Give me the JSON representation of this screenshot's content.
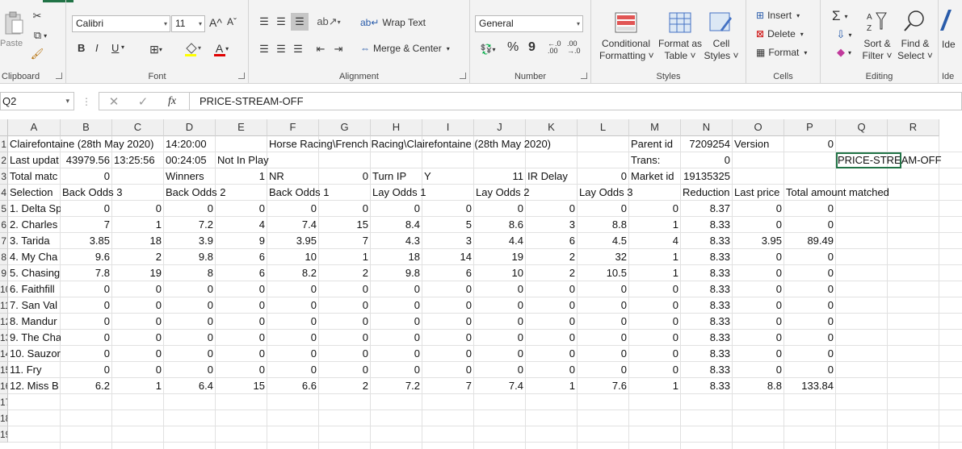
{
  "ribbon": {
    "clipboard": {
      "label": "Clipboard",
      "paste": "Paste"
    },
    "font": {
      "label": "Font",
      "name": "Calibri",
      "size": "11",
      "grow": "A^",
      "shrink": "Aˇ",
      "bold": "B",
      "italic": "I",
      "underline": "U",
      "font_color_glyph": "A"
    },
    "alignment": {
      "label": "Alignment",
      "wrap": "Wrap Text",
      "merge": "Merge & Center"
    },
    "number": {
      "label": "Number",
      "format": "General",
      "percent": "%",
      "comma": "9",
      "inc_dec": "←.0 .00",
      "dec_dec": ".00 →.0"
    },
    "styles": {
      "label": "Styles",
      "cond_line1": "Conditional",
      "cond_line2": "Formatting ˅",
      "table_line1": "Format as",
      "table_line2": "Table ˅",
      "cell_line1": "Cell",
      "cell_line2": "Styles ˅"
    },
    "cells": {
      "label": "Cells",
      "insert": "Insert",
      "delete": "Delete",
      "format": "Format"
    },
    "editing": {
      "label": "Editing",
      "sort_line1": "Sort &",
      "sort_line2": "Filter ˅",
      "find_line1": "Find &",
      "find_line2": "Select ˅",
      "sigma": "Σ"
    },
    "ideas": {
      "label": "Ide",
      "btn": "Ide"
    }
  },
  "formula_bar": {
    "name_box": "Q2",
    "fx": "fx",
    "content": "PRICE-STREAM-OFF"
  },
  "columns": [
    "A",
    "B",
    "C",
    "D",
    "E",
    "F",
    "G",
    "H",
    "I",
    "J",
    "K",
    "L",
    "M",
    "N",
    "O",
    "P",
    "Q",
    "R"
  ],
  "row_numbers": [
    "1",
    "2",
    "3",
    "4",
    "5",
    "6",
    "7",
    "8",
    "9",
    "10",
    "11",
    "12",
    "13",
    "14",
    "15",
    "16",
    "17",
    "18",
    "19"
  ],
  "rows": [
    [
      "Clairefontaine (28th May 2020)",
      "",
      "",
      "14:20:00",
      "",
      "Horse Racing\\French Racing\\Clairefontaine (28th May 2020)",
      "",
      "",
      "",
      "",
      "",
      "",
      "Parent id",
      "7209254",
      "Version",
      "0",
      "",
      ""
    ],
    [
      "Last updat",
      "43979.56",
      "13:25:56",
      "00:24:05",
      "Not In Play",
      "",
      "",
      "",
      "",
      "",
      "",
      "",
      "Trans:",
      "0",
      "",
      "",
      "PRICE-STREAM-OFF",
      ""
    ],
    [
      "Total matc",
      "0",
      "",
      "Winners",
      "1",
      "NR",
      "0",
      "Turn IP",
      "Y",
      "11",
      "IR Delay",
      "0",
      "Market id",
      "19135325",
      "",
      "",
      "",
      ""
    ],
    [
      "Selection",
      "Back Odds 3",
      "",
      "Back Odds 2",
      "",
      "Back Odds 1",
      "",
      "Lay Odds 1",
      "",
      "Lay Odds 2",
      "",
      "Lay Odds 3",
      "",
      "Reduction",
      "Last price",
      "Total amount matched",
      "",
      ""
    ],
    [
      "1. Delta Sp",
      "0",
      "0",
      "0",
      "0",
      "0",
      "0",
      "0",
      "0",
      "0",
      "0",
      "0",
      "0",
      "8.37",
      "0",
      "0",
      "",
      ""
    ],
    [
      "2. Charles",
      "7",
      "1",
      "7.2",
      "4",
      "7.4",
      "15",
      "8.4",
      "5",
      "8.6",
      "3",
      "8.8",
      "1",
      "8.33",
      "0",
      "0",
      "",
      ""
    ],
    [
      "3. Tarida",
      "3.85",
      "18",
      "3.9",
      "9",
      "3.95",
      "7",
      "4.3",
      "3",
      "4.4",
      "6",
      "4.5",
      "4",
      "8.33",
      "3.95",
      "89.49",
      "",
      ""
    ],
    [
      "4. My Cha",
      "9.6",
      "2",
      "9.8",
      "6",
      "10",
      "1",
      "18",
      "14",
      "19",
      "2",
      "32",
      "1",
      "8.33",
      "0",
      "0",
      "",
      ""
    ],
    [
      "5. Chasing",
      "7.8",
      "19",
      "8",
      "6",
      "8.2",
      "2",
      "9.8",
      "6",
      "10",
      "2",
      "10.5",
      "1",
      "8.33",
      "0",
      "0",
      "",
      ""
    ],
    [
      "6. Faithfill",
      "0",
      "0",
      "0",
      "0",
      "0",
      "0",
      "0",
      "0",
      "0",
      "0",
      "0",
      "0",
      "8.33",
      "0",
      "0",
      "",
      ""
    ],
    [
      "7. San Val",
      "0",
      "0",
      "0",
      "0",
      "0",
      "0",
      "0",
      "0",
      "0",
      "0",
      "0",
      "0",
      "8.33",
      "0",
      "0",
      "",
      ""
    ],
    [
      "8. Mandur",
      "0",
      "0",
      "0",
      "0",
      "0",
      "0",
      "0",
      "0",
      "0",
      "0",
      "0",
      "0",
      "8.33",
      "0",
      "0",
      "",
      ""
    ],
    [
      "9. The Cha",
      "0",
      "0",
      "0",
      "0",
      "0",
      "0",
      "0",
      "0",
      "0",
      "0",
      "0",
      "0",
      "8.33",
      "0",
      "0",
      "",
      ""
    ],
    [
      "10. Sauzor",
      "0",
      "0",
      "0",
      "0",
      "0",
      "0",
      "0",
      "0",
      "0",
      "0",
      "0",
      "0",
      "8.33",
      "0",
      "0",
      "",
      ""
    ],
    [
      "11. Fry",
      "0",
      "0",
      "0",
      "0",
      "0",
      "0",
      "0",
      "0",
      "0",
      "0",
      "0",
      "0",
      "8.33",
      "0",
      "0",
      "",
      ""
    ],
    [
      "12. Miss B",
      "6.2",
      "1",
      "6.4",
      "15",
      "6.6",
      "2",
      "7.2",
      "7",
      "7.4",
      "1",
      "7.6",
      "1",
      "8.33",
      "8.8",
      "133.84",
      "",
      ""
    ],
    [
      "",
      "",
      "",
      "",
      "",
      "",
      "",
      "",
      "",
      "",
      "",
      "",
      "",
      "",
      "",
      "",
      "",
      ""
    ],
    [
      "",
      "",
      "",
      "",
      "",
      "",
      "",
      "",
      "",
      "",
      "",
      "",
      "",
      "",
      "",
      "",
      "",
      ""
    ],
    [
      "",
      "",
      "",
      "",
      "",
      "",
      "",
      "",
      "",
      "",
      "",
      "",
      "",
      "",
      "",
      "",
      "",
      ""
    ]
  ],
  "text_cells": [
    "A1",
    "D1",
    "F1",
    "M1",
    "O1",
    "A2",
    "E2",
    "M2",
    "Q2",
    "A3",
    "D3",
    "F3",
    "H3",
    "I3",
    "K3",
    "M3",
    "A4",
    "B4",
    "D4",
    "F4",
    "H4",
    "J4",
    "L4",
    "N4",
    "O4",
    "P4"
  ],
  "selected_cell": "Q2",
  "accent": "#217346"
}
